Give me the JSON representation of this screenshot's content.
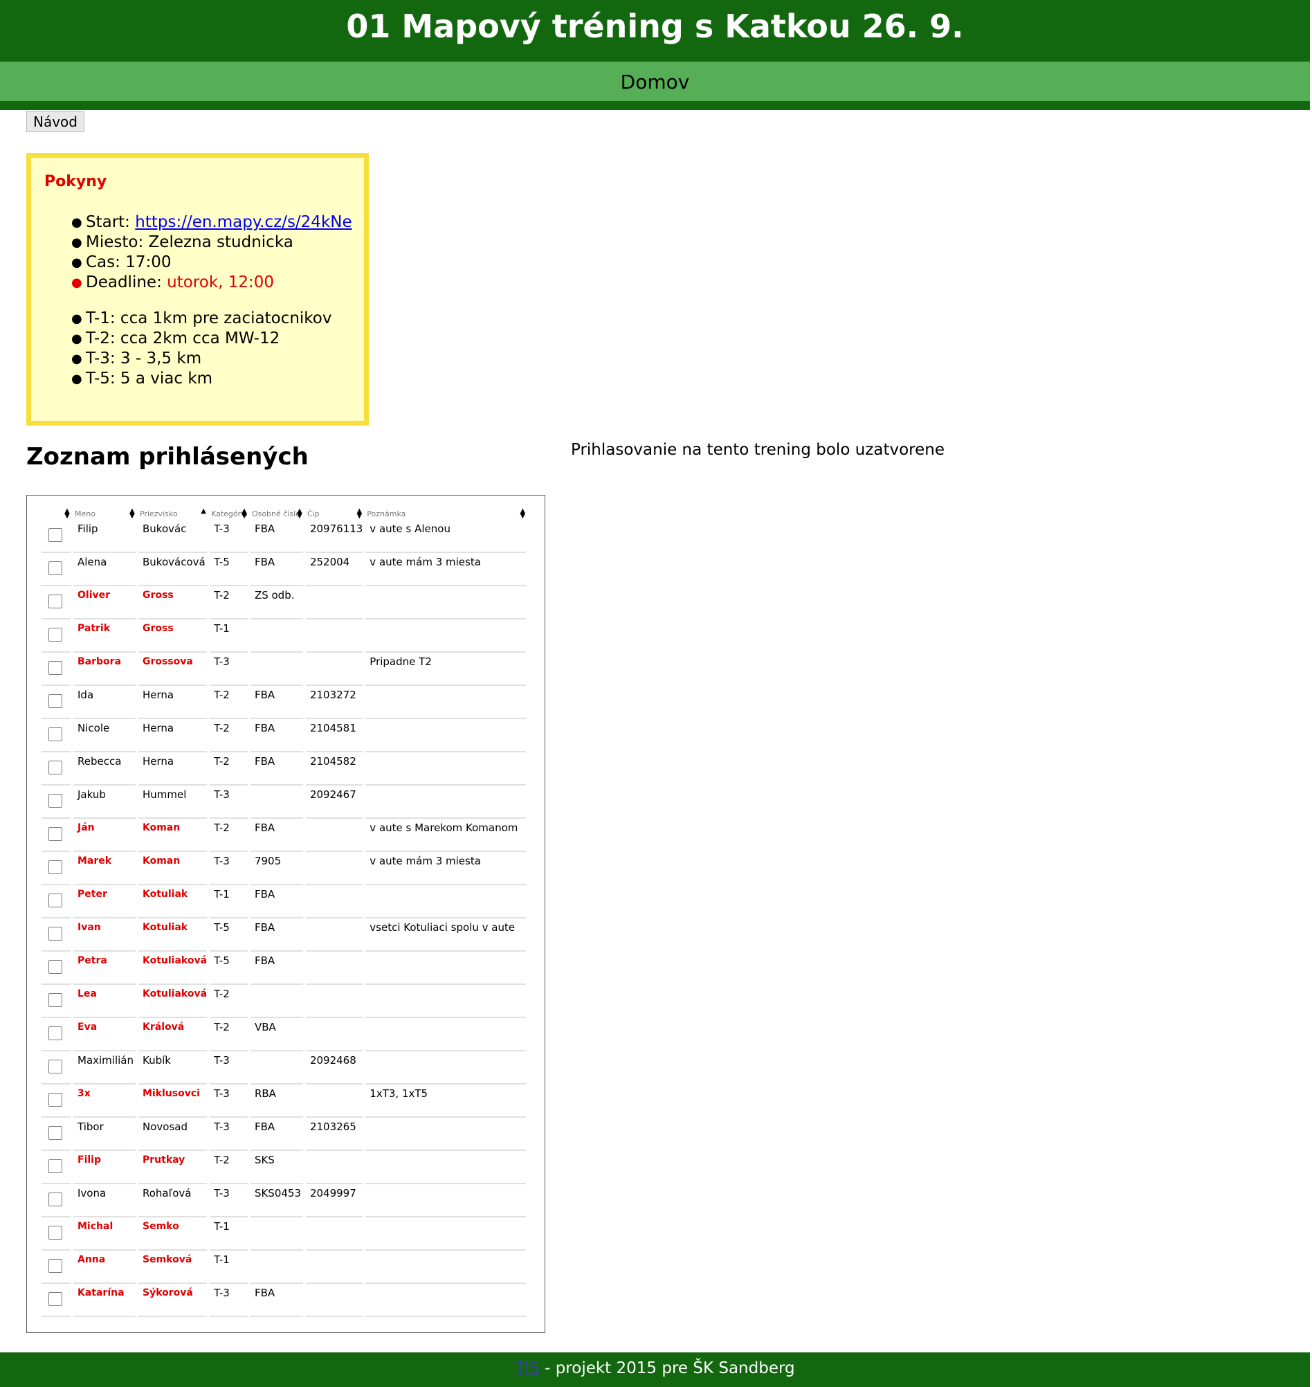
{
  "header": {
    "title": "01 Mapový tréning s Katkou 26. 9."
  },
  "nav": {
    "home": "Domov"
  },
  "help_button": "Návod",
  "instructions": {
    "title": "Pokyny",
    "items": [
      {
        "label": "Start: ",
        "value": "https://en.mapy.cz/s/24kNe",
        "type": "link"
      },
      {
        "label": "Miesto: ",
        "value": "Zelezna studnicka",
        "type": "text"
      },
      {
        "label": "Cas: ",
        "value": "17:00",
        "type": "text"
      },
      {
        "label": "Deadline: ",
        "value": "utorok, 12:00",
        "type": "red"
      }
    ],
    "tracks": [
      "T-1: cca 1km pre zaciatocnikov",
      "T-2: cca 2km cca MW-12",
      "T-3: 3 - 3,5 km",
      "T-5: 5 a viac km"
    ]
  },
  "registered": {
    "heading": "Zoznam prihlásených",
    "closed_message": "Prihlasovanie na tento trening bolo uzatvorene",
    "columns": [
      "Meno",
      "Priezvisko",
      "Kategória",
      "Osobné číslo",
      "Čip",
      "Poznámka"
    ],
    "sorted_column": "Priezvisko",
    "rows": [
      {
        "first": "Filip",
        "last": "Bukovác",
        "cat": "T-3",
        "id": "FBA",
        "chip": "20976113",
        "note": "v aute s Alenou",
        "highlight": false
      },
      {
        "first": "Alena",
        "last": "Bukovácová",
        "cat": "T-5",
        "id": "FBA",
        "chip": "252004",
        "note": "v aute mám 3 miesta",
        "highlight": false
      },
      {
        "first": "Oliver",
        "last": "Gross",
        "cat": "T-2",
        "id": "ZS odb.",
        "chip": "",
        "note": "",
        "highlight": true
      },
      {
        "first": "Patrik",
        "last": "Gross",
        "cat": "T-1",
        "id": "",
        "chip": "",
        "note": "",
        "highlight": true
      },
      {
        "first": "Barbora",
        "last": "Grossova",
        "cat": "T-3",
        "id": "",
        "chip": "",
        "note": "Pripadne T2",
        "highlight": true
      },
      {
        "first": "Ida",
        "last": "Herna",
        "cat": "T-2",
        "id": "FBA",
        "chip": "2103272",
        "note": "",
        "highlight": false
      },
      {
        "first": "Nicole",
        "last": "Herna",
        "cat": "T-2",
        "id": "FBA",
        "chip": "2104581",
        "note": "",
        "highlight": false
      },
      {
        "first": "Rebecca",
        "last": "Herna",
        "cat": "T-2",
        "id": "FBA",
        "chip": "2104582",
        "note": "",
        "highlight": false
      },
      {
        "first": "Jakub",
        "last": "Hummel",
        "cat": "T-3",
        "id": "",
        "chip": "2092467",
        "note": "",
        "highlight": false
      },
      {
        "first": "Ján",
        "last": "Koman",
        "cat": "T-2",
        "id": "FBA",
        "chip": "",
        "note": "v aute s Marekom Komanom",
        "highlight": true
      },
      {
        "first": "Marek",
        "last": "Koman",
        "cat": "T-3",
        "id": "7905",
        "chip": "",
        "note": "v aute mám 3 miesta",
        "highlight": true
      },
      {
        "first": "Peter",
        "last": "Kotuliak",
        "cat": "T-1",
        "id": "FBA",
        "chip": "",
        "note": "",
        "highlight": true
      },
      {
        "first": "Ivan",
        "last": "Kotuliak",
        "cat": "T-5",
        "id": "FBA",
        "chip": "",
        "note": "vsetci Kotuliaci spolu v aute",
        "highlight": true
      },
      {
        "first": "Petra",
        "last": "Kotuliaková",
        "cat": "T-5",
        "id": "FBA",
        "chip": "",
        "note": "",
        "highlight": true
      },
      {
        "first": "Lea",
        "last": "Kotuliaková",
        "cat": "T-2",
        "id": "",
        "chip": "",
        "note": "",
        "highlight": true
      },
      {
        "first": "Eva",
        "last": "Králová",
        "cat": "T-2",
        "id": "VBA",
        "chip": "",
        "note": "",
        "highlight": true
      },
      {
        "first": "Maximilián",
        "last": "Kubík",
        "cat": "T-3",
        "id": "",
        "chip": "2092468",
        "note": "",
        "highlight": false
      },
      {
        "first": "3x",
        "last": "Miklusovci",
        "cat": "T-3",
        "id": "RBA",
        "chip": "",
        "note": "1xT3, 1xT5",
        "highlight": true
      },
      {
        "first": "Tibor",
        "last": "Novosad",
        "cat": "T-3",
        "id": "FBA",
        "chip": "2103265",
        "note": "",
        "highlight": false
      },
      {
        "first": "Filip",
        "last": "Prutkay",
        "cat": "T-2",
        "id": "SKS",
        "chip": "",
        "note": "",
        "highlight": true
      },
      {
        "first": "Ivona",
        "last": "Rohaľová",
        "cat": "T-3",
        "id": "SKS0453",
        "chip": "2049997",
        "note": "",
        "highlight": false
      },
      {
        "first": "Michal",
        "last": "Semko",
        "cat": "T-1",
        "id": "",
        "chip": "",
        "note": "",
        "highlight": true
      },
      {
        "first": "Anna",
        "last": "Semková",
        "cat": "T-1",
        "id": "",
        "chip": "",
        "note": "",
        "highlight": true
      },
      {
        "first": "Katarína",
        "last": "Sýkorová",
        "cat": "T-3",
        "id": "FBA",
        "chip": "",
        "note": "",
        "highlight": true
      }
    ]
  },
  "footer": {
    "link": "TIS",
    "text": " - projekt 2015 pre ŠK Sandberg"
  },
  "colors": {
    "dark_green": "#12670f",
    "light_green": "#56ae56",
    "highlight_red": "#e00000",
    "note_bg": "#ffffc7",
    "note_border": "#f6df3b"
  }
}
